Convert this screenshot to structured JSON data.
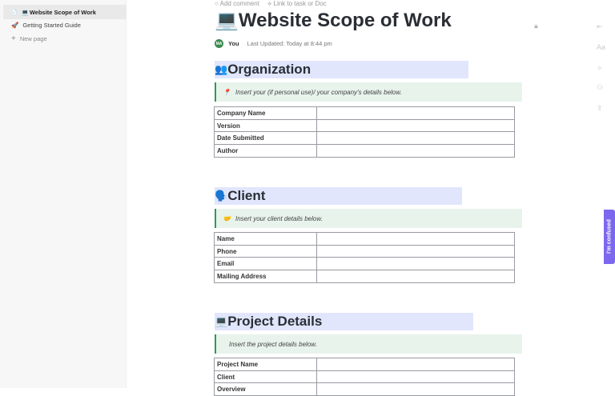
{
  "sidebar": {
    "items": [
      {
        "icon": "📄",
        "emoji": "💻",
        "label": "Website Scope of Work"
      },
      {
        "icon": "🚀",
        "label": "Getting Started Guide"
      },
      {
        "icon": "+",
        "label": "New page"
      }
    ]
  },
  "topbar": {
    "add_comment": "Add comment",
    "link_task": "Link to task or Doc"
  },
  "doc": {
    "title_emoji": "💻",
    "title": "Website Scope of Work",
    "author": "You",
    "avatar": "MA",
    "last_updated": "Last Updated: Today at 8:44 pm",
    "sections": [
      {
        "emoji": "👥",
        "heading": "Organization",
        "callout_icon": "📍",
        "callout": "Insert your (if personal use)/ your company's details below.",
        "rows": [
          "Company Name",
          "Version",
          "Date Submitted",
          "Author"
        ]
      },
      {
        "emoji": "🗣️",
        "heading": "Client",
        "callout_icon": "🤝",
        "callout": "Insert your client details below.",
        "rows": [
          "Name",
          "Phone",
          "Email",
          "Mailing Address"
        ]
      },
      {
        "emoji": "💻",
        "heading": "Project Details",
        "callout_icon": "",
        "callout": "Insert the project details below.",
        "rows": [
          "Project Name",
          "Client",
          "Overview"
        ]
      }
    ]
  },
  "right_tools": [
    "collapse",
    "Aa",
    "magic",
    "collab",
    "share"
  ],
  "feedback": "I'm confused"
}
